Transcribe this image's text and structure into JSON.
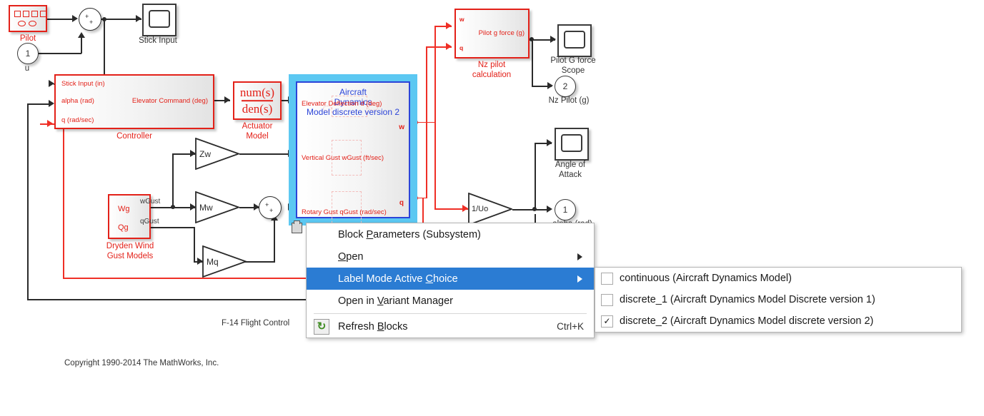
{
  "diagram": {
    "title": "F-14 Flight Control",
    "copyright": "Copyright 1990-2014 The MathWorks, Inc."
  },
  "blocks": {
    "pilot": {
      "label": "Pilot"
    },
    "stick_scope": {
      "label": "Stick Input"
    },
    "u_inport": {
      "number": "1",
      "label": "u"
    },
    "controller": {
      "label": "Controller",
      "in1": "Stick Input (in)",
      "in2": "alpha (rad)",
      "in3": "q (rad/sec)",
      "out1": "Elevator Command (deg)"
    },
    "actuator": {
      "label": "Actuator\nModel",
      "numerator": "num(s)",
      "denominator": "den(s)"
    },
    "aircraft": {
      "title_line1": "Aircraft",
      "title_line2": "Dynamics",
      "title_line3": "Model discrete version 2",
      "in1": "Elevator Deflection d (deg)",
      "in2": "Vertical Gust wGust (ft/sec)",
      "in3": "Rotary Gust qGust (rad/sec)",
      "out1": "w",
      "out2": "q"
    },
    "dryden": {
      "label": "Dryden Wind\nGust Models",
      "out1": "Wg",
      "out2": "Qg",
      "sig1": "wGust",
      "sig2": "qGust"
    },
    "gain_zw": {
      "label": "Zw"
    },
    "gain_mw": {
      "label": "Mw"
    },
    "gain_mq": {
      "label": "Mq"
    },
    "gain_uo": {
      "label": "1/Uo"
    },
    "nz_pilot": {
      "label": "Nz pilot\ncalculation",
      "in1": "w",
      "in2": "q",
      "out1": "Pilot g force (g)"
    },
    "pilot_g_scope": {
      "label": "Pilot G force\nScope"
    },
    "nz_outport": {
      "number": "2",
      "label": "Nz Pilot (g)"
    },
    "aoa_scope": {
      "label": "Angle of\nAttack"
    },
    "alpha_outport": {
      "number": "1",
      "label": "alpha (rad)"
    },
    "sum1": {
      "s1": "+",
      "s2": "+"
    },
    "sum2": {
      "s1": "+",
      "s2": "+"
    }
  },
  "context_menu": {
    "items": [
      {
        "label": "Block Parameters (Subsystem)",
        "accel": "P",
        "selected": false,
        "submenu": false,
        "shortcut": "",
        "icon": ""
      },
      {
        "label": "Open",
        "accel": "O",
        "selected": false,
        "submenu": true,
        "shortcut": "",
        "icon": ""
      },
      {
        "label": "Label Mode Active Choice",
        "accel": "C",
        "selected": true,
        "submenu": true,
        "shortcut": "",
        "icon": ""
      },
      {
        "label": "Open in Variant Manager",
        "accel": "V",
        "selected": false,
        "submenu": false,
        "shortcut": "",
        "icon": ""
      },
      {
        "label": "Refresh Blocks",
        "accel": "B",
        "selected": false,
        "submenu": false,
        "shortcut": "Ctrl+K",
        "icon": "refresh-icon"
      }
    ]
  },
  "submenu": {
    "items": [
      {
        "label": "continuous (Aircraft Dynamics Model)",
        "checked": false
      },
      {
        "label": "discrete_1 (Aircraft Dynamics Model Discrete version 1)",
        "checked": false
      },
      {
        "label": "discrete_2 (Aircraft Dynamics Model discrete version 2)",
        "checked": true
      }
    ],
    "check_glyph": "✓"
  },
  "colors": {
    "block_red": "#e32119",
    "signal_red": "#ef2f26",
    "selection_blue": "#5cc8f2",
    "subsystem_blue": "#2b44d8",
    "menu_highlight": "#2b7cd3"
  }
}
